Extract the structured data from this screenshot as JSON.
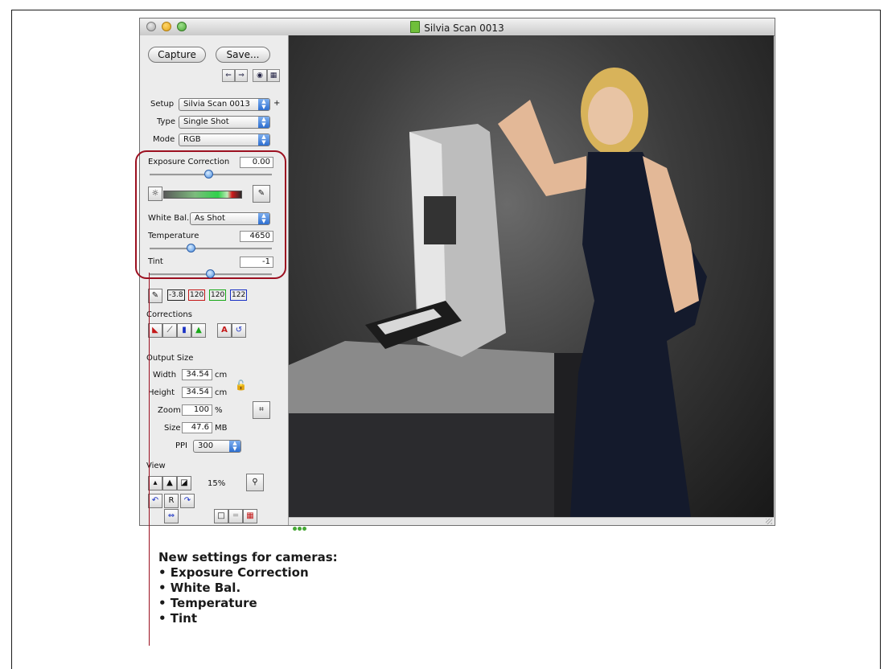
{
  "window": {
    "title": "Silvia Scan 0013"
  },
  "panel": {
    "capture_label": "Capture",
    "save_label": "Save...",
    "setup_label": "Setup",
    "setup_value": "Silvia Scan 0013",
    "setup_plus": "+",
    "type_label": "Type",
    "type_value": "Single Shot",
    "mode_label": "Mode",
    "mode_value": "RGB",
    "exposure_label": "Exposure Correction",
    "exposure_value": "0.00",
    "white_bal_label": "White Bal.",
    "white_bal_value": "As Shot",
    "temperature_label": "Temperature",
    "temperature_value": "4650",
    "tint_label": "Tint",
    "tint_value": "-1",
    "density_values": [
      "-3.8",
      "120",
      "120",
      "122"
    ],
    "corrections_label": "Corrections",
    "output_size_label": "Output Size",
    "width_label": "Width",
    "width_value": "34.54",
    "width_unit": "cm",
    "height_label": "Height",
    "height_value": "34.54",
    "height_unit": "cm",
    "zoom_label": "Zoom",
    "zoom_value": "100",
    "zoom_unit": "%",
    "size_label": "Size",
    "size_value": "47.6",
    "size_unit": "MB",
    "ppi_label": "PPI",
    "ppi_value": "300",
    "view_label": "View",
    "view_zoom": "15%",
    "rotate_reset_label": "R",
    "auto_label": "A"
  },
  "caption": {
    "heading": "New settings for cameras:",
    "items": [
      "• Exposure Correction",
      "• White Bal.",
      "• Temperature",
      "• Tint"
    ]
  },
  "colors": {
    "highlight": "#9c1020",
    "accent_blue": "#2d6fd0"
  }
}
